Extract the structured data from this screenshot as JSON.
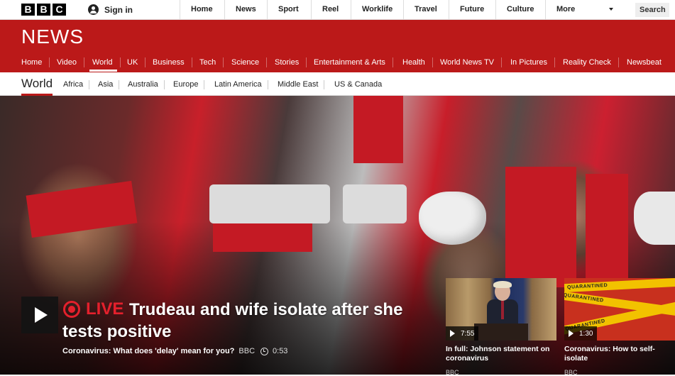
{
  "brand": {
    "logo_letters": [
      "B",
      "B",
      "C"
    ]
  },
  "account": {
    "signin_label": "Sign in"
  },
  "top_nav": {
    "items": [
      "Home",
      "News",
      "Sport",
      "Reel",
      "Worklife",
      "Travel",
      "Future",
      "Culture"
    ],
    "more_label": "More",
    "search_label": "Search"
  },
  "section": {
    "title": "NEWS",
    "nav": [
      "Home",
      "Video",
      "World",
      "UK",
      "Business",
      "Tech",
      "Science",
      "Stories",
      "Entertainment & Arts",
      "Health",
      "World News TV",
      "In Pictures",
      "Reality Check",
      "Newsbeat"
    ],
    "active": "World"
  },
  "sub_nav": {
    "current": "World",
    "items": [
      "Africa",
      "Asia",
      "Australia",
      "Europe",
      "Latin America",
      "Middle East",
      "US & Canada"
    ]
  },
  "lead_story": {
    "live_label": "LIVE",
    "headline": "Trudeau and wife isolate after she tests positive",
    "summary": "Coronavirus: What does 'delay' mean for you?",
    "source": "BBC",
    "duration": "0:53"
  },
  "side_stories": [
    {
      "duration": "7:55",
      "title": "In full: Johnson statement on coronavirus",
      "meta": "BBC"
    },
    {
      "duration": "1:30",
      "title": "Coronavirus: How to self-isolate",
      "meta": "BBC",
      "tape_text": "QUARANTINED"
    }
  ],
  "colors": {
    "brand_red": "#bb1919",
    "live_red": "#e4202c",
    "tape_yellow": "#f2c200"
  }
}
